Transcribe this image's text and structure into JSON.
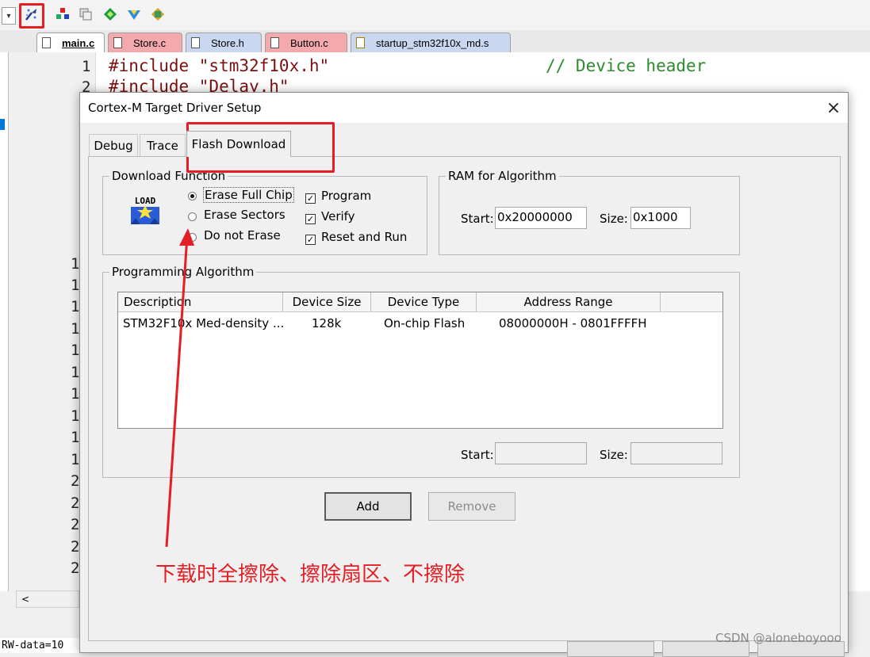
{
  "toolbar": {
    "icons": [
      "dropdown-icon",
      "target-options-icon",
      "manage-components-icon",
      "copy-icon",
      "select-packs-icon",
      "pack-installer-icon",
      "map-icon"
    ]
  },
  "file_tabs": [
    "main.c",
    "Store.c",
    "Store.h",
    "Button.c",
    "startup_stm32f10x_md.s"
  ],
  "editor": {
    "line1_num": "1",
    "line1_code": "#include \"stm32f10x.h\"",
    "line1_comment": "// Device header",
    "line2_num": "2",
    "line2_code": "#include \"Delay.h\"",
    "gutter_digits": [
      "1",
      "1",
      "1",
      "1",
      "1",
      "1",
      "1",
      "1",
      "1",
      "1",
      "2",
      "2",
      "2",
      "2",
      "2"
    ]
  },
  "status_text": "RW-data=10",
  "dialog": {
    "title": "Cortex-M Target Driver Setup",
    "close": "×",
    "tabs": [
      "Debug",
      "Trace",
      "Flash Download"
    ],
    "download_function": {
      "label": "Download Function",
      "load_icon_text": "LOAD",
      "radios": [
        "Erase Full Chip",
        "Erase Sectors",
        "Do not Erase"
      ],
      "selected_radio": "Erase Full Chip",
      "checks": [
        "Program",
        "Verify",
        "Reset and Run"
      ]
    },
    "ram": {
      "label": "RAM for Algorithm",
      "start_label": "Start:",
      "start_value": "0x20000000",
      "size_label": "Size:",
      "size_value": "0x1000"
    },
    "algorithm": {
      "label": "Programming Algorithm",
      "columns": [
        "Description",
        "Device Size",
        "Device Type",
        "Address Range"
      ],
      "rows": [
        {
          "description": "STM32F10x Med-density ...",
          "size": "128k",
          "type": "On-chip Flash",
          "range": "08000000H - 0801FFFFH"
        }
      ],
      "start_label": "Start:",
      "size_label": "Size:",
      "add": "Add",
      "remove": "Remove"
    }
  },
  "annotation": "下载时全擦除、擦除扇区、不擦除",
  "watermark": "CSDN @aloneboyooo",
  "colors": {
    "highlight": "#e31e24",
    "keyword": "#7a1010",
    "comment": "#2e8b2e"
  }
}
